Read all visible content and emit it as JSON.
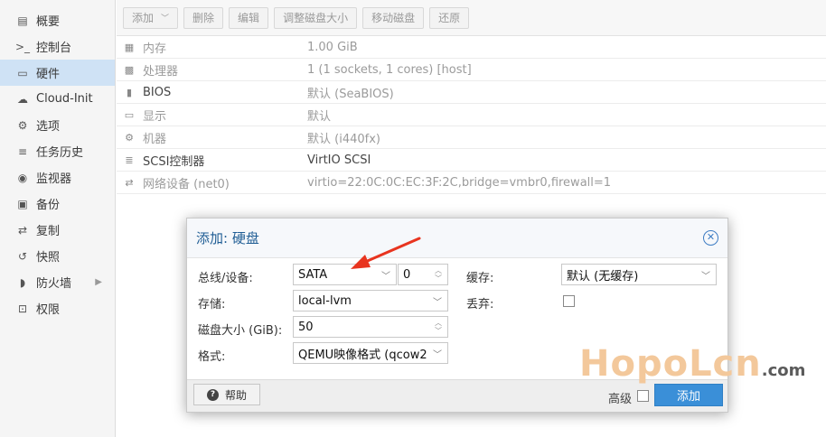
{
  "sidebar": {
    "items": [
      {
        "label": "概要",
        "icon": "book-icon",
        "glyph": "▤"
      },
      {
        "label": "控制台",
        "icon": "terminal-icon",
        "glyph": ">_"
      },
      {
        "label": "硬件",
        "icon": "desktop-icon",
        "glyph": "▭"
      },
      {
        "label": "Cloud-Init",
        "icon": "cloud-icon",
        "glyph": "☁"
      },
      {
        "label": "选项",
        "icon": "gear-icon",
        "glyph": "⚙"
      },
      {
        "label": "任务历史",
        "icon": "list-icon",
        "glyph": "≡"
      },
      {
        "label": "监视器",
        "icon": "eye-icon",
        "glyph": "◉"
      },
      {
        "label": "备份",
        "icon": "floppy-icon",
        "glyph": "▣"
      },
      {
        "label": "复制",
        "icon": "retweet-icon",
        "glyph": "⇄"
      },
      {
        "label": "快照",
        "icon": "history-icon",
        "glyph": "↺"
      },
      {
        "label": "防火墙",
        "icon": "shield-icon",
        "glyph": "◗"
      },
      {
        "label": "权限",
        "icon": "unlock-icon",
        "glyph": "⊡"
      }
    ]
  },
  "toolbar": {
    "add": "添加",
    "remove": "删除",
    "edit": "编辑",
    "resize": "调整磁盘大小",
    "move": "移动磁盘",
    "revert": "还原"
  },
  "hardware": [
    {
      "name": "内存",
      "value": "1.00 GiB",
      "icon": "memory-icon",
      "glyph": "▦"
    },
    {
      "name": "处理器",
      "value": "1 (1 sockets, 1 cores) [host]",
      "icon": "cpu-icon",
      "glyph": "▩"
    },
    {
      "name": "BIOS",
      "value": "默认 (SeaBIOS)",
      "icon": "chip-icon",
      "glyph": "▮"
    },
    {
      "name": "显示",
      "value": "默认",
      "icon": "monitor-icon",
      "glyph": "▭"
    },
    {
      "name": "机器",
      "value": "默认 (i440fx)",
      "icon": "cogs-icon",
      "glyph": "⚙"
    },
    {
      "name": "SCSI控制器",
      "value": "VirtIO SCSI",
      "icon": "database-icon",
      "glyph": "≣"
    },
    {
      "name": "网络设备 (net0)",
      "value": "virtio=22:0C:0C:EC:3F:2C,bridge=vmbr0,firewall=1",
      "icon": "network-icon",
      "glyph": "⇄"
    }
  ],
  "dialog": {
    "title": "添加: 硬盘",
    "bus_label": "总线/设备:",
    "bus_value": "SATA",
    "device_value": "0",
    "storage_label": "存储:",
    "storage_value": "local-lvm",
    "size_label": "磁盘大小 (GiB):",
    "size_value": "50",
    "format_label": "格式:",
    "format_value": "QEMU映像格式 (qcow2",
    "cache_label": "缓存:",
    "cache_value": "默认 (无缓存)",
    "discard_label": "丢弃:",
    "help": "帮助",
    "advanced": "高级",
    "add": "添加"
  },
  "watermark": {
    "main": "HopoLcn",
    "suffix": ".com"
  },
  "colors": {
    "accent": "#3a8fd8",
    "arrow": "#e8341f",
    "watermark": "#f3c89b"
  }
}
